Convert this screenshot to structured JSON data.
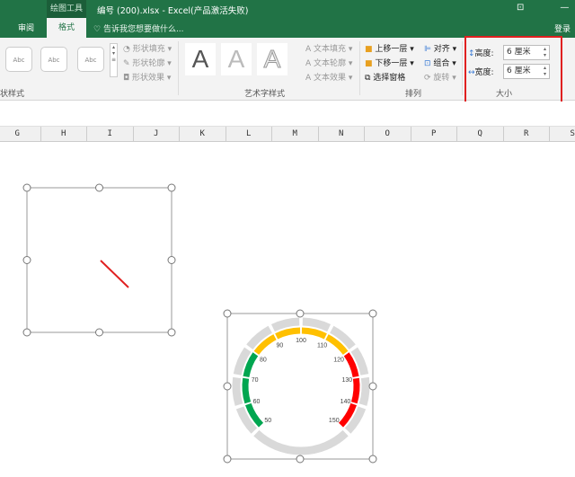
{
  "titlebar": {
    "tool_context": "绘图工具",
    "title": "编号 (200).xlsx - Excel(产品激活失败)",
    "login": "登录",
    "restore_icon": "ribbon-display-icon",
    "minimize": "—"
  },
  "tabs": {
    "review": "审阅",
    "format": "格式",
    "tell_me": "告诉我您想要做什么..."
  },
  "shape_styles": {
    "sample": "Abc",
    "fill": "形状填充",
    "outline": "形状轮廓",
    "effects": "形状效果",
    "group_label": "状样式"
  },
  "wordart": {
    "letter": "A",
    "fill": "文本填充",
    "outline": "文本轮廓",
    "effects": "文本效果",
    "group_label": "艺术字样式"
  },
  "arrange": {
    "bring_forward": "上移一层",
    "send_backward": "下移一层",
    "selection_pane": "选择窗格",
    "align": "对齐",
    "group": "组合",
    "rotate": "旋转",
    "group_label": "排列"
  },
  "size": {
    "height_label": "高度:",
    "height_value": "6 厘米",
    "width_label": "宽度:",
    "width_value": "6 厘米",
    "group_label": "大小"
  },
  "columns": [
    "G",
    "H",
    "I",
    "J",
    "K",
    "L",
    "M",
    "N",
    "O",
    "P",
    "Q",
    "R",
    "S"
  ],
  "gauge": {
    "min": 50,
    "max": 150,
    "step": 10,
    "labels": [
      "50",
      "60",
      "70",
      "80",
      "90",
      "100",
      "110",
      "120",
      "130",
      "140",
      "150"
    ],
    "bands": [
      {
        "from": 50,
        "to": 80,
        "color": "#00a650"
      },
      {
        "from": 80,
        "to": 120,
        "color": "#ffc000"
      },
      {
        "from": 120,
        "to": 150,
        "color": "#ff0000"
      }
    ],
    "ring_color": "#d9d9d9"
  },
  "colors": {
    "accent": "#217346",
    "highlight": "#e02020"
  }
}
